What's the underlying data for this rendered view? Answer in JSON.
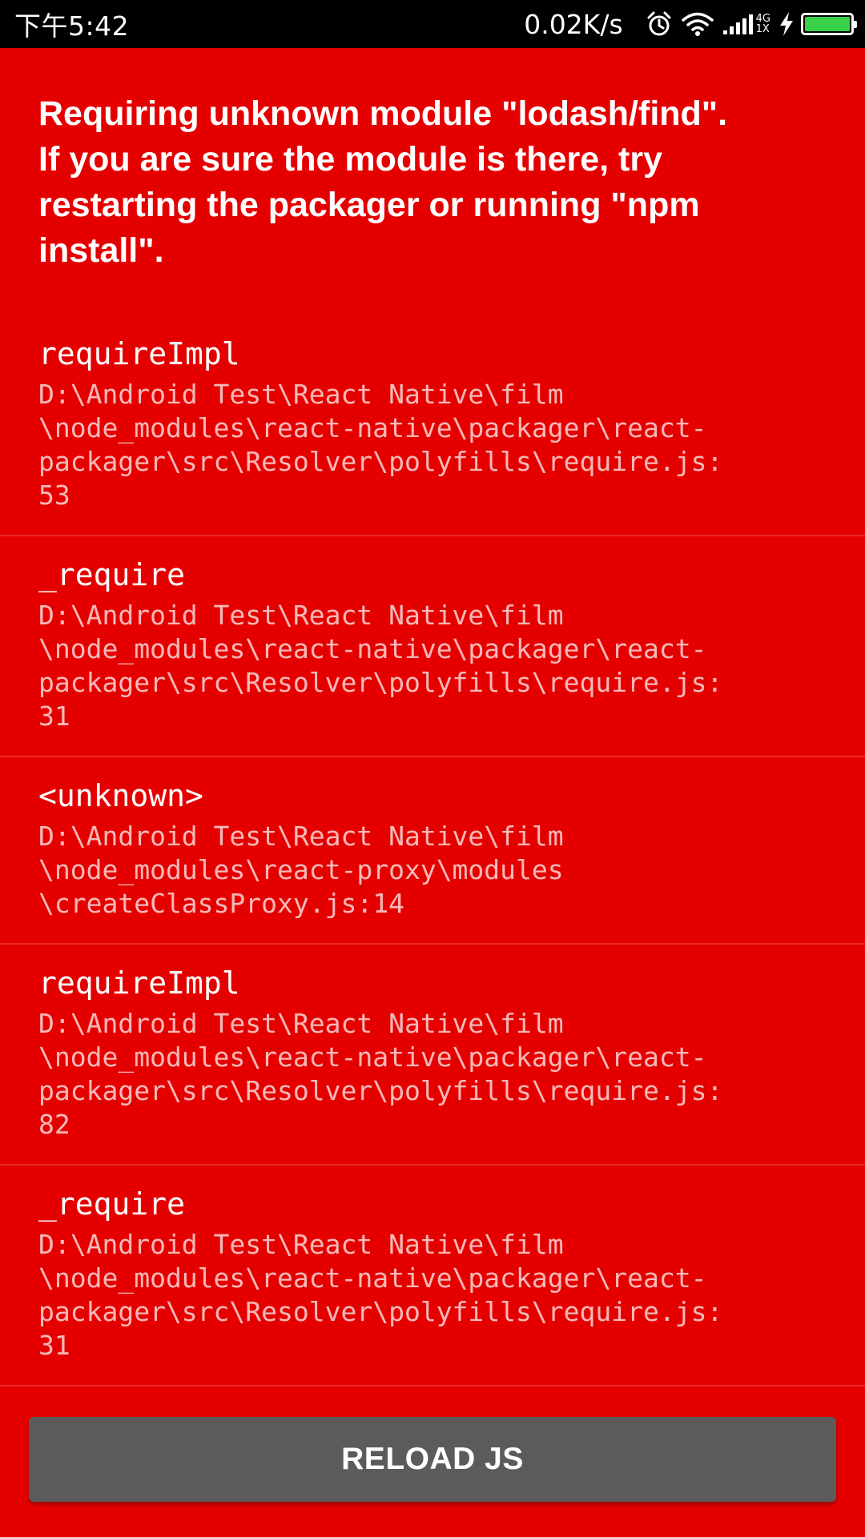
{
  "status_bar": {
    "time": "下午5:42",
    "net_speed": "0.02K/s",
    "network_type_top": "4G",
    "network_type_bottom": "1X",
    "battery_color": "#3ad14a"
  },
  "error": {
    "message": "Requiring unknown module \"lodash/find\".\nIf you are sure the module is there, try\nrestarting the packager or running \"npm\ninstall\"."
  },
  "stack": [
    {
      "method": "requireImpl",
      "location": "D:\\Android Test\\React Native\\film\n\\node_modules\\react-native\\packager\\react-\npackager\\src\\Resolver\\polyfills\\require.js:\n53"
    },
    {
      "method": "_require",
      "location": "D:\\Android Test\\React Native\\film\n\\node_modules\\react-native\\packager\\react-\npackager\\src\\Resolver\\polyfills\\require.js:\n31"
    },
    {
      "method": "<unknown>",
      "location": "D:\\Android Test\\React Native\\film\n\\node_modules\\react-proxy\\modules\n\\createClassProxy.js:14"
    },
    {
      "method": "requireImpl",
      "location": "D:\\Android Test\\React Native\\film\n\\node_modules\\react-native\\packager\\react-\npackager\\src\\Resolver\\polyfills\\require.js:\n82"
    },
    {
      "method": "_require",
      "location": "D:\\Android Test\\React Native\\film\n\\node_modules\\react-native\\packager\\react-\npackager\\src\\Resolver\\polyfills\\require.js:\n31"
    }
  ],
  "actions": {
    "reload_label": "RELOAD JS"
  },
  "colors": {
    "background": "#e50000",
    "button": "#5b5b5b"
  }
}
